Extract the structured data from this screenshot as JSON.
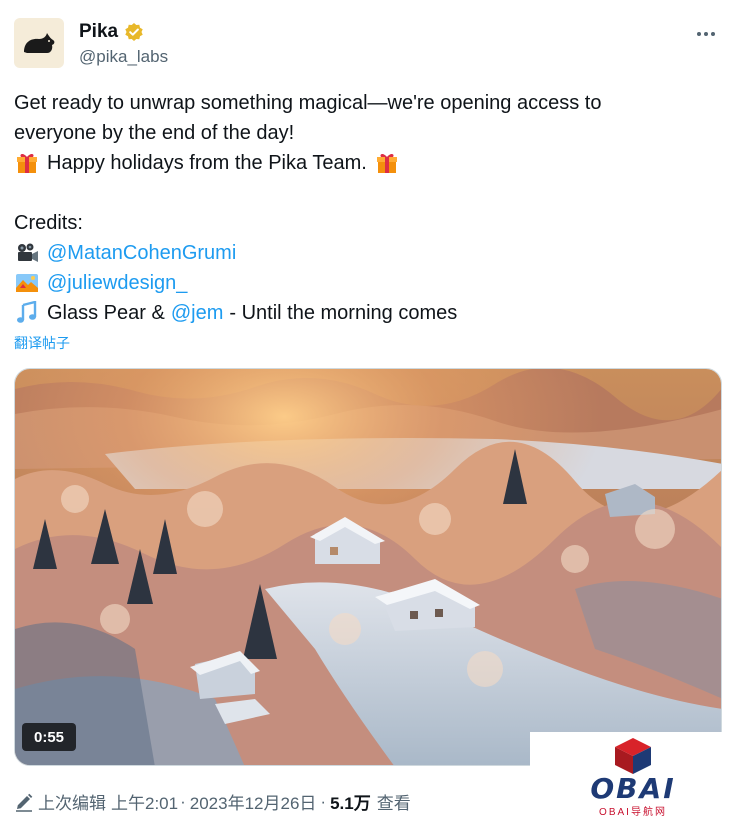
{
  "author": {
    "display_name": "Pika",
    "handle": "@pika_labs",
    "verified": true
  },
  "tweet": {
    "line1": "Get ready to unwrap something magical—we're opening access to",
    "line2": "everyone by the end of the day!",
    "line3": "Happy holidays from the Pika Team.",
    "credits_label": "Credits:",
    "credit1_link": "@MatanCohenGrumi",
    "credit2_link": "@juliewdesign_",
    "credit3_prefix": "Glass Pear &",
    "credit3_link": "@jem",
    "credit3_suffix": "- Until the morning comes",
    "translate_label": "翻译帖子"
  },
  "media": {
    "duration": "0:55"
  },
  "meta": {
    "edited_label": "上次编辑",
    "time": "上午2:01",
    "date": "2023年12月26日",
    "separator": "·",
    "views_count": "5.1万",
    "views_label": "查看"
  },
  "watermark": {
    "brand": "OBAI",
    "subtitle": "OBAI导航网"
  },
  "icons": {
    "more": "more-horizontal-icon",
    "verified": "verified-badge-icon",
    "gift": "gift-icon",
    "camera": "movie-camera-icon",
    "picture": "art-picture-icon",
    "music": "music-notes-icon",
    "edit": "edit-pencil-icon"
  },
  "colors": {
    "link": "#1d9bf0",
    "text": "#0f1419",
    "secondary": "#536471",
    "verified_gold": "#e8b82a"
  }
}
